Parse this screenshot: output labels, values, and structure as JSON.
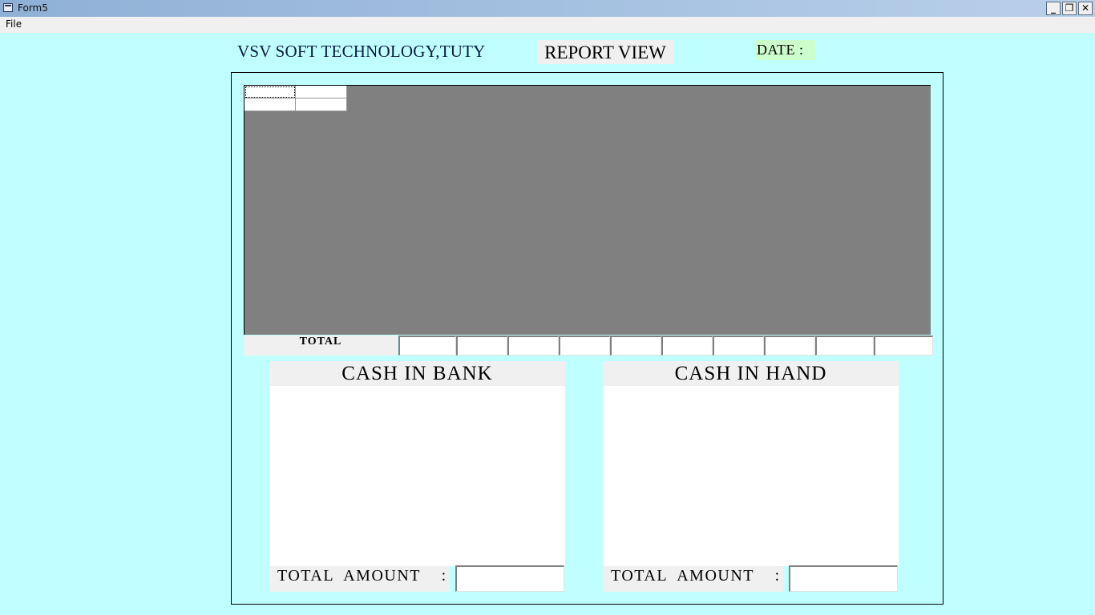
{
  "window": {
    "title": "Form5",
    "minimize_glyph": "_",
    "restore_glyph": "❐",
    "close_glyph": "✕"
  },
  "menu": {
    "items": [
      "File"
    ]
  },
  "header": {
    "company": "VSV SOFT TECHNOLOGY,TUTY",
    "report_title": "REPORT VIEW",
    "date_label": "DATE :"
  },
  "grid": {
    "rows": 2,
    "cols": 2,
    "cells": [
      [
        "",
        ""
      ],
      [
        "",
        ""
      ]
    ]
  },
  "totals_row": {
    "label": "TOTAL",
    "values": [
      "",
      "",
      "",
      "",
      "",
      "",
      "",
      "",
      "",
      ""
    ]
  },
  "cash_in_bank": {
    "title": "CASH IN BANK",
    "total_label": "TOTAL  AMOUNT    :",
    "total_value": ""
  },
  "cash_in_hand": {
    "title": "CASH IN HAND",
    "total_label": "TOTAL  AMOUNT    :",
    "total_value": ""
  },
  "colors": {
    "form_background": "#c0ffff",
    "grid_background": "#808080",
    "date_label_background": "#ccffcc",
    "label_background": "#f0f0f0"
  }
}
